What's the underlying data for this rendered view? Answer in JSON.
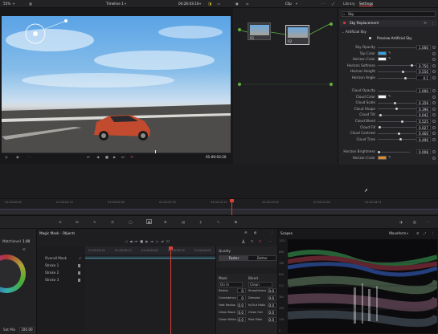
{
  "top_bar": {
    "zoom": "55%",
    "timeline_name": "Timeline 1",
    "timecode": "04:26:03:16",
    "clip_mode": "Clip",
    "library_tab": "Library",
    "settings_tab": "Settings"
  },
  "viewer": {
    "timecode": "01:00:03:20"
  },
  "nodes": [
    {
      "label": "01"
    },
    {
      "label": "02"
    }
  ],
  "settings": {
    "search_placeholder": "Sky",
    "effect_title": "Sky Replacement",
    "section": "Artificial Sky",
    "preview_label": "Preview Artificial Sky",
    "sky_params": [
      {
        "label": "Sky Opacity",
        "value": "1.000"
      },
      {
        "label": "Top Color",
        "value": ""
      },
      {
        "label": "Horizon Color",
        "value": ""
      },
      {
        "label": "Horizon Softness",
        "value": "0.750"
      },
      {
        "label": "Horizon Height",
        "value": "0.550"
      },
      {
        "label": "Horizon Angle",
        "value": "4.1"
      }
    ],
    "cloud_params": [
      {
        "label": "Cloud Opacity",
        "value": "1.000"
      },
      {
        "label": "Cloud Color",
        "value": ""
      },
      {
        "label": "Cloud Scale",
        "value": "0.359"
      },
      {
        "label": "Cloud Shape",
        "value": "0.396"
      },
      {
        "label": "Cloud Tilt",
        "value": "0.042"
      },
      {
        "label": "Cloud Blend",
        "value": "0.525"
      },
      {
        "label": "Cloud Fill",
        "value": "0.027"
      },
      {
        "label": "Cloud Contrast",
        "value": "0.460"
      },
      {
        "label": "Cloud Time",
        "value": "0.490"
      }
    ],
    "horizon_params": [
      {
        "label": "Horizon Brightness",
        "value": "0.008"
      },
      {
        "label": "Horizon Color",
        "value": ""
      }
    ],
    "colors": {
      "top": "#2fa5e8",
      "horizon": "#f2f4f7",
      "cloud": "#f2f2f2",
      "horizon_bottom": "#e08a2e"
    }
  },
  "timeline": {
    "ticks": [
      "01:00:00:00",
      "01:00:02:13",
      "01:00:05:06",
      "01:00:07:19",
      "01:00:10:12",
      "01:00:13:05",
      "01:00:15:18",
      "01:00:18:11"
    ]
  },
  "magic_mask": {
    "title": "Magic Mask - Objects",
    "panel_label": "Quality",
    "tab_faster": "Faster",
    "tab_better": "Better",
    "tracks": [
      {
        "label": "Overall Mask"
      },
      {
        "label": "Stroke 1"
      },
      {
        "label": "Stroke 2"
      },
      {
        "label": "Stroke 3"
      }
    ],
    "ticks": [
      "01:00:03:14",
      "01:00:03:17",
      "01:00:03:20",
      "01:00:03:23",
      "01:00:04:02"
    ],
    "left_header": "Mask",
    "left_header2": "Blend",
    "settings_rows": [
      {
        "label": "Radius",
        "value": "0",
        "label2": "Smoothness",
        "value2": "0.0"
      },
      {
        "label": "Consistency",
        "value": "0",
        "label2": "Denoise",
        "value2": "0.0"
      },
      {
        "label": "Feat Radius",
        "value": "0.0",
        "label2": "In/Out Ratio",
        "value2": "0.0"
      },
      {
        "label": "Clean Black",
        "value": "0.0",
        "label2": "Clean Out",
        "value2": "0.0"
      },
      {
        "label": "Clean White",
        "value": "0.0",
        "label2": "Post Filter",
        "value2": "0.0"
      }
    ],
    "mode_a": "On In",
    "mode_b": "Clean",
    "bottom_label": "Sat Mix",
    "bottom_value": "100.00",
    "matchlevel_label": "Matchlevel",
    "matchlevel_value": "1.00"
  },
  "scopes": {
    "title": "Scopes",
    "mode": "Waveform",
    "scale": [
      "1023",
      "896",
      "768",
      "640",
      "512",
      "384",
      "256",
      "128",
      "0"
    ]
  }
}
